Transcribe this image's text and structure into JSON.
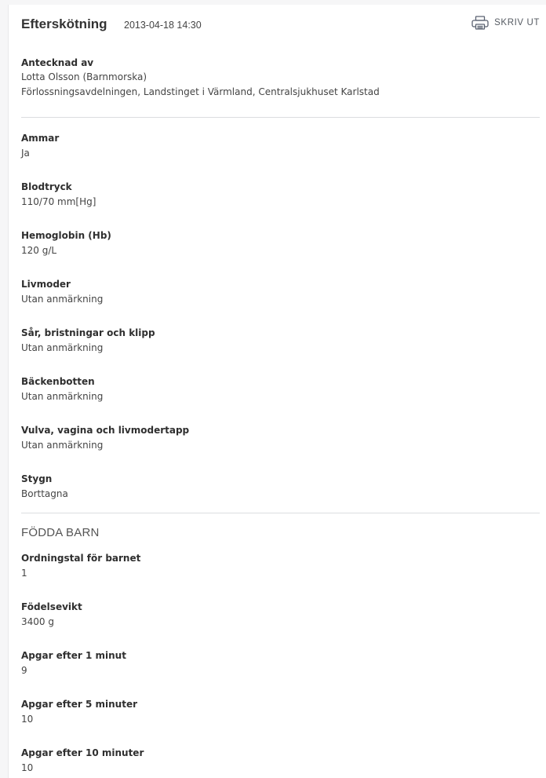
{
  "header": {
    "title": "Efterskötning",
    "datetime": "2013-04-18 14:30",
    "print_label": "SKRIV UT",
    "print_icon": "printer-icon"
  },
  "author": {
    "label": "Antecknad av",
    "name": "Lotta Olsson (Barnmorska)",
    "unit": "Förlossningsavdelningen, Landstinget i Värmland, Centralsjukhuset Karlstad"
  },
  "fields": [
    {
      "label": "Ammar",
      "value": "Ja"
    },
    {
      "label": "Blodtryck",
      "value": "110/70 mm[Hg]"
    },
    {
      "label": "Hemoglobin (Hb)",
      "value": "120 g/L"
    },
    {
      "label": "Livmoder",
      "value": "Utan anmärkning"
    },
    {
      "label": "Sår, bristningar och klipp",
      "value": "Utan anmärkning"
    },
    {
      "label": "Bäckenbotten",
      "value": "Utan anmärkning"
    },
    {
      "label": "Vulva, vagina och livmodertapp",
      "value": "Utan anmärkning"
    },
    {
      "label": "Stygn",
      "value": "Borttagna"
    }
  ],
  "born_children": {
    "title": "FÖDDA BARN",
    "fields": [
      {
        "label": "Ordningstal för barnet",
        "value": "1"
      },
      {
        "label": "Födelsevikt",
        "value": "3400 g"
      },
      {
        "label": "Apgar efter 1 minut",
        "value": "9"
      },
      {
        "label": "Apgar efter 5 minuter",
        "value": "10"
      },
      {
        "label": "Apgar efter 10 minuter",
        "value": "10"
      }
    ]
  }
}
